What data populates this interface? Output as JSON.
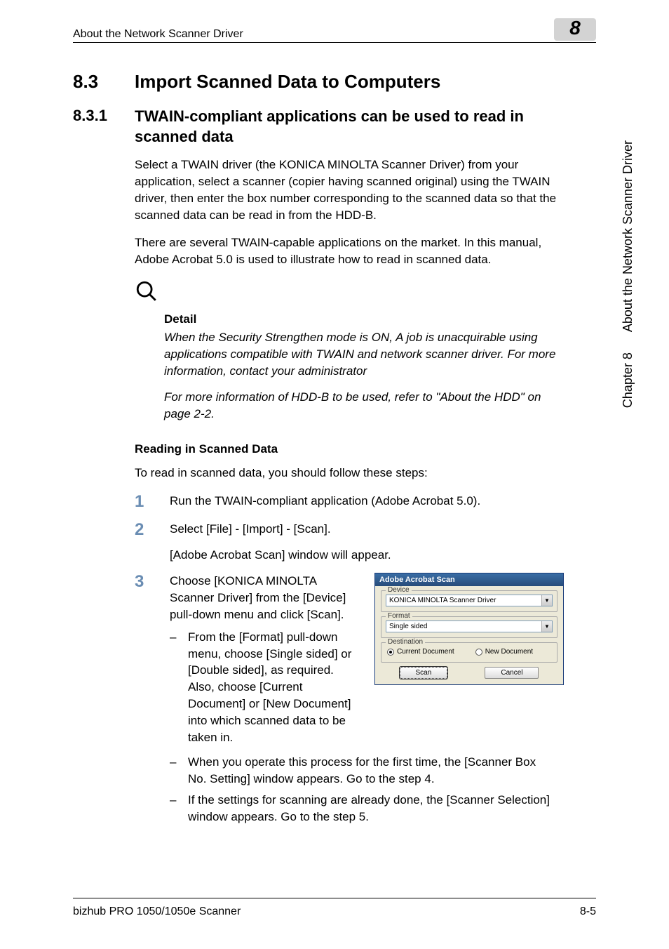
{
  "header": {
    "left": "About the Network Scanner Driver",
    "chapter_num": "8"
  },
  "side": {
    "chapter": "Chapter 8",
    "title": "About the Network Scanner Driver"
  },
  "section": {
    "num": "8.3",
    "title": "Import Scanned Data to Computers"
  },
  "subsection": {
    "num": "8.3.1",
    "title": "TWAIN-compliant applications can be used to read in scanned data"
  },
  "para1": "Select a TWAIN driver (the KONICA MINOLTA Scanner Driver) from your application, select a scanner (copier having scanned original) using the TWAIN driver, then enter the box number corresponding to the scanned data so that the scanned data can be read in from the HDD-B.",
  "para2": "There are several TWAIN-capable applications on the market. In this manual, Adobe Acrobat 5.0 is used to illustrate how to read in scanned data.",
  "detail": {
    "heading": "Detail",
    "text1": "When the Security Strengthen mode is ON, A job is unacquirable using applications compatible with TWAIN and network scanner driver. For more information, contact your administrator",
    "text2": "For more information of HDD-B to be used, refer to \"About the HDD\" on page 2-2."
  },
  "reading": {
    "heading": "Reading in Scanned Data",
    "intro": "To read in scanned data, you should follow these steps:",
    "steps": {
      "s1": {
        "num": "1",
        "text": "Run the TWAIN-compliant application (Adobe Acrobat 5.0)."
      },
      "s2": {
        "num": "2",
        "text": "Select [File] - [Import] - [Scan].",
        "sub": "[Adobe Acrobat Scan] window will appear."
      },
      "s3": {
        "num": "3",
        "text": "Choose [KONICA MINOLTA Scanner Driver] from the [Device] pull-down menu and click [Scan].",
        "dash1": "From the [Format] pull-down menu, choose [Single sided] or [Double sided], as required. Also, choose [Current Document] or [New Document] into which scanned data to be taken in.",
        "dash2": "When you operate this process for the first time, the [Scanner Box No. Setting] window appears. Go to the step 4.",
        "dash3": "If the settings for scanning are already done, the [Scanner Selection] window appears. Go to the step 5."
      }
    }
  },
  "scan_window": {
    "title": "Adobe Acrobat Scan",
    "device_legend": "Device",
    "device_value": "KONICA MINOLTA Scanner Driver",
    "format_legend": "Format",
    "format_value": "Single sided",
    "dest_legend": "Destination",
    "dest_current": "Current Document",
    "dest_new": "New Document",
    "btn_scan": "Scan",
    "btn_cancel": "Cancel"
  },
  "footer": {
    "left": "bizhub PRO 1050/1050e Scanner",
    "right": "8-5"
  },
  "dash": "–"
}
